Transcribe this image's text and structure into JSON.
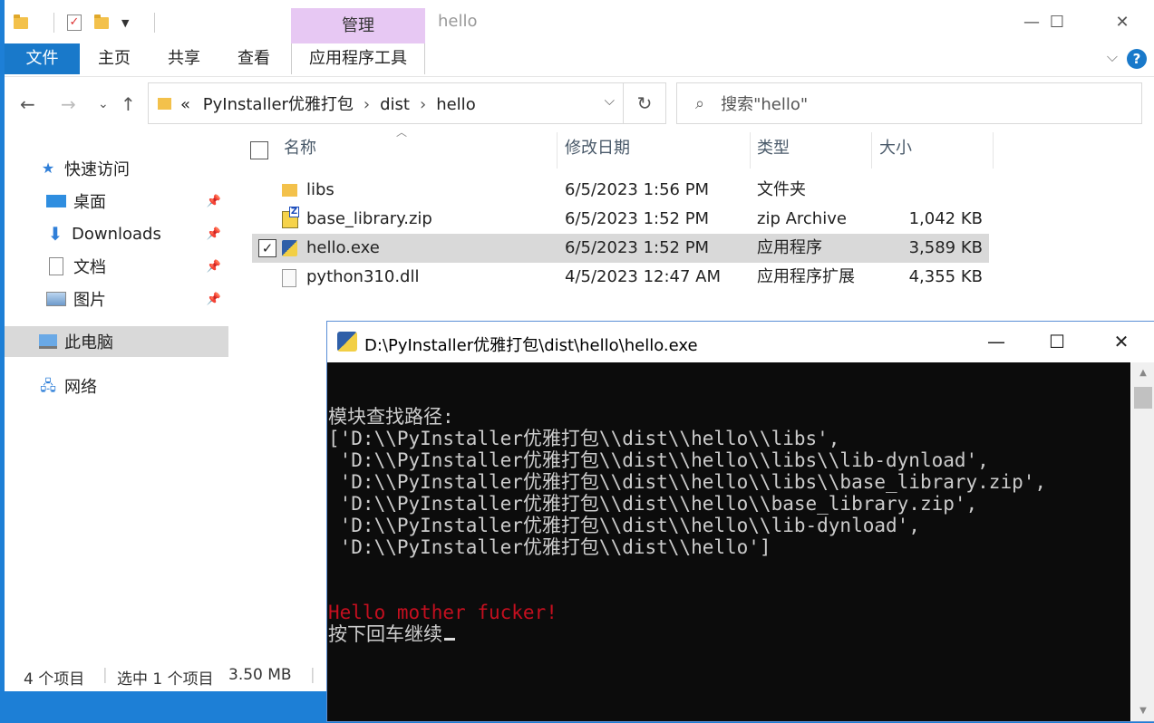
{
  "explorer": {
    "window_title": "hello",
    "context_tab": "管理",
    "controls": {
      "minimize": "—",
      "maximize": "☐",
      "close": "✕"
    },
    "ribbon": {
      "tabs": [
        "文件",
        "主页",
        "共享",
        "查看",
        "应用程序工具"
      ],
      "collapse_glyph": "⌵",
      "help": "?"
    },
    "address": {
      "prefix": "«",
      "segments": [
        "PyInstaller优雅打包",
        "dist",
        "hello"
      ],
      "separator": "›",
      "dropdown": "⌵",
      "refresh": "↻"
    },
    "search": {
      "placeholder": "搜索\"hello\"",
      "icon": "search-icon"
    },
    "nav_buttons": {
      "back": "←",
      "forward": "→",
      "recent": "⌄",
      "up": "↑"
    },
    "nav_pane": {
      "items": [
        {
          "label": "快速访问",
          "icon": "star-icon"
        },
        {
          "label": "桌面",
          "icon": "desktop-icon",
          "pinned": true
        },
        {
          "label": "Downloads",
          "icon": "download-icon",
          "pinned": true
        },
        {
          "label": "文档",
          "icon": "document-icon",
          "pinned": true
        },
        {
          "label": "图片",
          "icon": "picture-icon",
          "pinned": true
        },
        {
          "label": "此电脑",
          "icon": "computer-icon",
          "selected": true
        },
        {
          "label": "网络",
          "icon": "network-icon"
        }
      ]
    },
    "columns": {
      "name": "名称",
      "modified": "修改日期",
      "type": "类型",
      "size": "大小"
    },
    "files": [
      {
        "name": "libs",
        "modified": "6/5/2023 1:56 PM",
        "type": "文件夹",
        "size": "",
        "icon": "folder-icon"
      },
      {
        "name": "base_library.zip",
        "modified": "6/5/2023 1:52 PM",
        "type": "zip Archive",
        "size": "1,042 KB",
        "icon": "zip-icon"
      },
      {
        "name": "hello.exe",
        "modified": "6/5/2023 1:52 PM",
        "type": "应用程序",
        "size": "3,589 KB",
        "icon": "exe-icon",
        "selected": true
      },
      {
        "name": "python310.dll",
        "modified": "4/5/2023 12:47 AM",
        "type": "应用程序扩展",
        "size": "4,355 KB",
        "icon": "dll-icon"
      }
    ],
    "status": {
      "count": "4 个项目",
      "selection": "选中 1 个项目",
      "size": "3.50 MB"
    }
  },
  "console": {
    "title": "D:\\PyInstaller优雅打包\\dist\\hello\\hello.exe",
    "lines": [
      "模块查找路径:",
      "['D:\\\\PyInstaller优雅打包\\\\dist\\\\hello\\\\libs',",
      " 'D:\\\\PyInstaller优雅打包\\\\dist\\\\hello\\\\libs\\\\lib-dynload',",
      " 'D:\\\\PyInstaller优雅打包\\\\dist\\\\hello\\\\libs\\\\base_library.zip',",
      " 'D:\\\\PyInstaller优雅打包\\\\dist\\\\hello\\\\base_library.zip',",
      " 'D:\\\\PyInstaller优雅打包\\\\dist\\\\hello\\\\lib-dynload',",
      " 'D:\\\\PyInstaller优雅打包\\\\dist\\\\hello']"
    ],
    "message": "Hello mother fucker!",
    "prompt": "按下回车继续",
    "colors": {
      "background": "#0c0c0c",
      "text": "#cccccc",
      "message": "#c50f1f"
    }
  }
}
